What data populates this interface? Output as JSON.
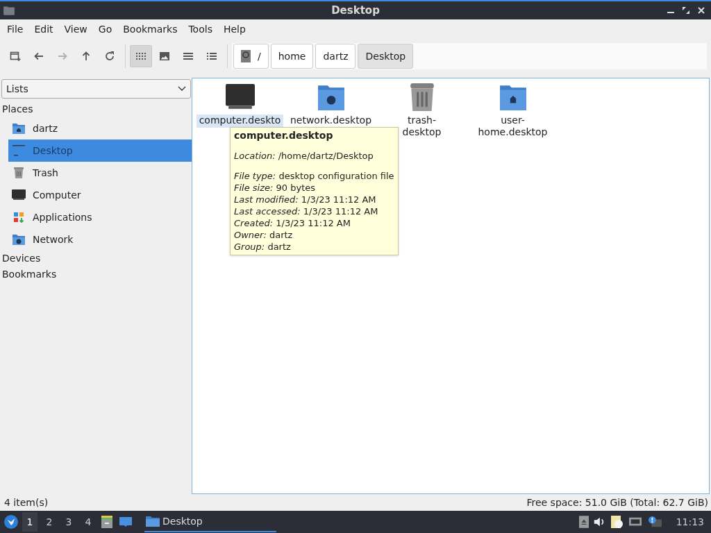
{
  "window": {
    "title": "Desktop"
  },
  "menu": [
    "File",
    "Edit",
    "View",
    "Go",
    "Bookmarks",
    "Tools",
    "Help"
  ],
  "toolbar": [
    {
      "kind": "new-tab",
      "disabled": false,
      "selected": false
    },
    {
      "kind": "back",
      "disabled": false,
      "selected": false
    },
    {
      "kind": "forward",
      "disabled": true,
      "selected": false
    },
    {
      "kind": "up",
      "disabled": false,
      "selected": false
    },
    {
      "kind": "reload",
      "disabled": false,
      "selected": false
    },
    {
      "kind": "icon-view",
      "disabled": false,
      "selected": true
    },
    {
      "kind": "thumbnail-view",
      "disabled": false,
      "selected": false
    },
    {
      "kind": "compact-view",
      "disabled": false,
      "selected": false
    },
    {
      "kind": "list-view",
      "disabled": false,
      "selected": false
    }
  ],
  "path": [
    {
      "label": "/",
      "kind": "root",
      "selected": false
    },
    {
      "label": "home",
      "kind": "dir",
      "selected": false
    },
    {
      "label": "dartz",
      "kind": "dir",
      "selected": false
    },
    {
      "label": "Desktop",
      "kind": "dir",
      "selected": true
    }
  ],
  "sidebar": {
    "mode": "Lists",
    "sections": [
      {
        "title": "Places",
        "items": [
          {
            "label": "dartz",
            "kind": "home",
            "selected": false
          },
          {
            "label": "Desktop",
            "kind": "desktop",
            "selected": true
          },
          {
            "label": "Trash",
            "kind": "trash",
            "selected": false
          },
          {
            "label": "Computer",
            "kind": "computer",
            "selected": false
          },
          {
            "label": "Applications",
            "kind": "apps",
            "selected": false
          },
          {
            "label": "Network",
            "kind": "network",
            "selected": false
          }
        ]
      },
      {
        "title": "Devices"
      },
      {
        "title": "Bookmarks"
      }
    ]
  },
  "files": [
    {
      "lines": [
        "computer.deskto"
      ],
      "kind": "computer",
      "selected": true
    },
    {
      "lines": [
        "network.desktop"
      ],
      "kind": "network",
      "selected": false
    },
    {
      "lines": [
        "trash-",
        "desktop"
      ],
      "kind": "trash",
      "selected": false
    },
    {
      "lines": [
        "user-",
        "home.desktop"
      ],
      "kind": "home",
      "selected": false
    }
  ],
  "tooltip": {
    "title": "computer.desktop",
    "groups": [
      [
        {
          "label": "Location:",
          "value": "/home/dartz/Desktop"
        }
      ],
      [
        {
          "label": "File type:",
          "value": "desktop configuration file"
        },
        {
          "label": "File size:",
          "value": "90 bytes"
        },
        {
          "label": "Last modified:",
          "value": "1/3/23 11:12 AM"
        },
        {
          "label": "Last accessed:",
          "value": "1/3/23 11:12 AM"
        },
        {
          "label": "Created:",
          "value": "1/3/23 11:12 AM"
        },
        {
          "label": "Owner:",
          "value": "dartz"
        },
        {
          "label": "Group:",
          "value": "dartz"
        }
      ]
    ]
  },
  "status_bar": {
    "items": "4 item(s)",
    "free_space": "Free space: 51.0 GiB (Total: 62.7 GiB)"
  },
  "taskbar": {
    "workspaces": [
      {
        "label": "1",
        "selected": true
      },
      {
        "label": "2",
        "selected": false
      },
      {
        "label": "3",
        "selected": false
      },
      {
        "label": "4",
        "selected": false
      }
    ],
    "task": "Desktop",
    "clock": "11:13"
  }
}
